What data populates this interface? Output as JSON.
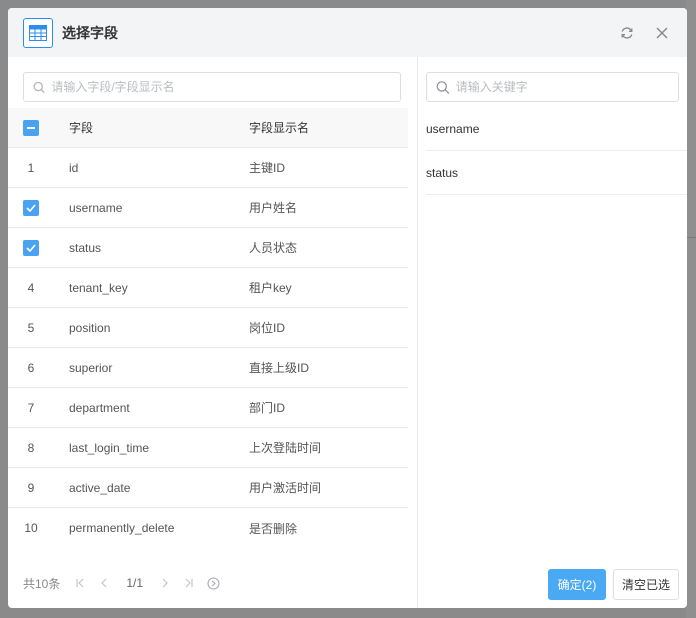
{
  "dialog": {
    "title": "选择字段"
  },
  "left": {
    "search_placeholder": "请输入字段/字段显示名",
    "columns": {
      "field": "字段",
      "display": "字段显示名"
    },
    "rows": [
      {
        "index": "1",
        "field": "id",
        "display": "主键ID",
        "checked": false
      },
      {
        "index": "2",
        "field": "username",
        "display": "用户姓名",
        "checked": true
      },
      {
        "index": "3",
        "field": "status",
        "display": "人员状态",
        "checked": true
      },
      {
        "index": "4",
        "field": "tenant_key",
        "display": "租户key",
        "checked": false
      },
      {
        "index": "5",
        "field": "position",
        "display": "岗位ID",
        "checked": false
      },
      {
        "index": "6",
        "field": "superior",
        "display": "直接上级ID",
        "checked": false
      },
      {
        "index": "7",
        "field": "department",
        "display": "部门ID",
        "checked": false
      },
      {
        "index": "8",
        "field": "last_login_time",
        "display": "上次登陆时间",
        "checked": false
      },
      {
        "index": "9",
        "field": "active_date",
        "display": "用户激活时间",
        "checked": false
      },
      {
        "index": "10",
        "field": "permanently_delete",
        "display": "是否删除",
        "checked": false
      }
    ],
    "pager": {
      "total": "共10条",
      "current": "1/1"
    }
  },
  "right": {
    "search_placeholder": "请输入关键字",
    "selected": [
      "username",
      "status"
    ],
    "ok_label": "确定(2)",
    "clear_label": "清空已选"
  },
  "colors": {
    "accent": "#4aa3f0",
    "primary_button": "#4aa9f3",
    "header_bg": "#f3f4f6"
  }
}
